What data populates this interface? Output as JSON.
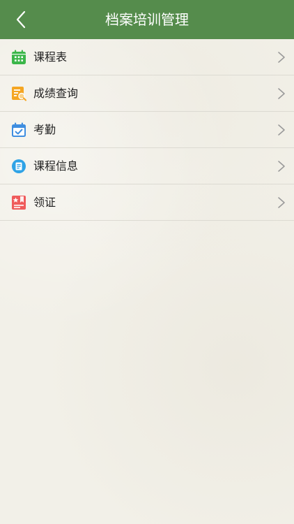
{
  "header": {
    "title": "档案培训管理",
    "back_icon": "chevron-left-icon",
    "background_color": "#558c4c"
  },
  "menu": {
    "items": [
      {
        "label": "课程表",
        "icon": "calendar-grid-icon",
        "icon_color": "#3cb64a"
      },
      {
        "label": "成绩查询",
        "icon": "search-document-icon",
        "icon_color": "#f5a623"
      },
      {
        "label": "考勤",
        "icon": "calendar-check-icon",
        "icon_color": "#3f8ee0"
      },
      {
        "label": "课程信息",
        "icon": "info-circle-icon",
        "icon_color": "#2fa3e6"
      },
      {
        "label": "领证",
        "icon": "certificate-icon",
        "icon_color": "#ef5b5b"
      }
    ],
    "chevron_icon": "chevron-right-icon"
  }
}
